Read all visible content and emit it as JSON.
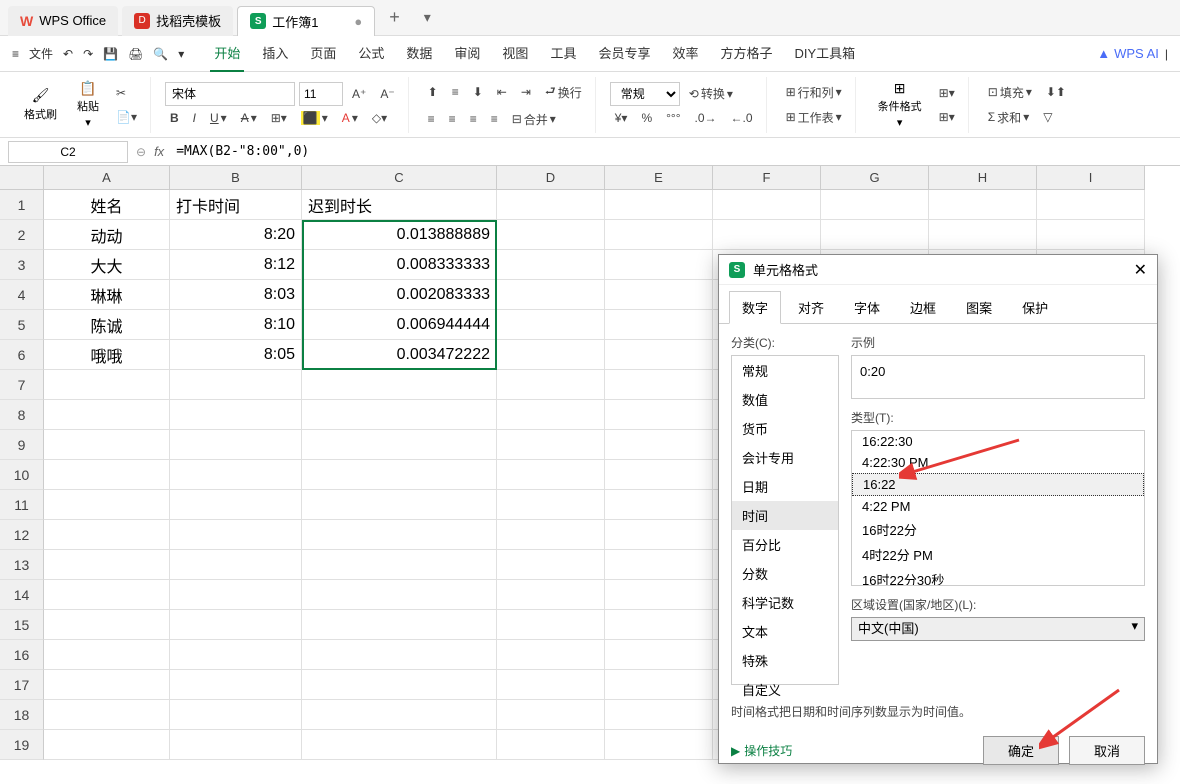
{
  "titlebar": {
    "app_name": "WPS Office",
    "template_tab": "找稻壳模板",
    "workbook_tab": "工作簿1"
  },
  "menubar": {
    "file": "文件",
    "tabs": [
      "开始",
      "插入",
      "页面",
      "公式",
      "数据",
      "审阅",
      "视图",
      "工具",
      "会员专享",
      "效率",
      "方方格子",
      "DIY工具箱"
    ],
    "ai": "WPS AI"
  },
  "ribbon": {
    "format_painter": "格式刷",
    "paste": "粘贴",
    "font": "宋体",
    "font_size": "11",
    "wrap": "换行",
    "merge": "合并",
    "general": "常规",
    "convert": "转换",
    "row_col": "行和列",
    "worksheet": "工作表",
    "cond_format": "条件格式",
    "fill": "填充",
    "sum": "求和"
  },
  "namebox": "C2",
  "formula": "=MAX(B2-\"8:00\",0)",
  "grid": {
    "cols": [
      "A",
      "B",
      "C",
      "D",
      "E",
      "F",
      "G",
      "H",
      "I"
    ],
    "headers": [
      "姓名",
      "打卡时间",
      "迟到时长"
    ],
    "data": [
      [
        "动动",
        "8:20",
        "0.013888889"
      ],
      [
        "大大",
        "8:12",
        "0.008333333"
      ],
      [
        "琳琳",
        "8:03",
        "0.002083333"
      ],
      [
        "陈诚",
        "8:10",
        "0.006944444"
      ],
      [
        "哦哦",
        "8:05",
        "0.003472222"
      ]
    ]
  },
  "dialog": {
    "title": "单元格格式",
    "tabs": [
      "数字",
      "对齐",
      "字体",
      "边框",
      "图案",
      "保护"
    ],
    "category_label": "分类(C):",
    "categories": [
      "常规",
      "数值",
      "货币",
      "会计专用",
      "日期",
      "时间",
      "百分比",
      "分数",
      "科学记数",
      "文本",
      "特殊",
      "自定义"
    ],
    "selected_category": "时间",
    "sample_label": "示例",
    "sample_value": "0:20",
    "type_label": "类型(T):",
    "types": [
      "16:22:30",
      "4:22:30 PM",
      "16:22",
      "4:22 PM",
      "16时22分",
      "4时22分 PM",
      "16时22分30秒"
    ],
    "selected_type": "16:22",
    "locale_label": "区域设置(国家/地区)(L):",
    "locale_value": "中文(中国)",
    "note": "时间格式把日期和时间序列数显示为时间值。",
    "tips_link": "操作技巧",
    "ok": "确定",
    "cancel": "取消"
  }
}
